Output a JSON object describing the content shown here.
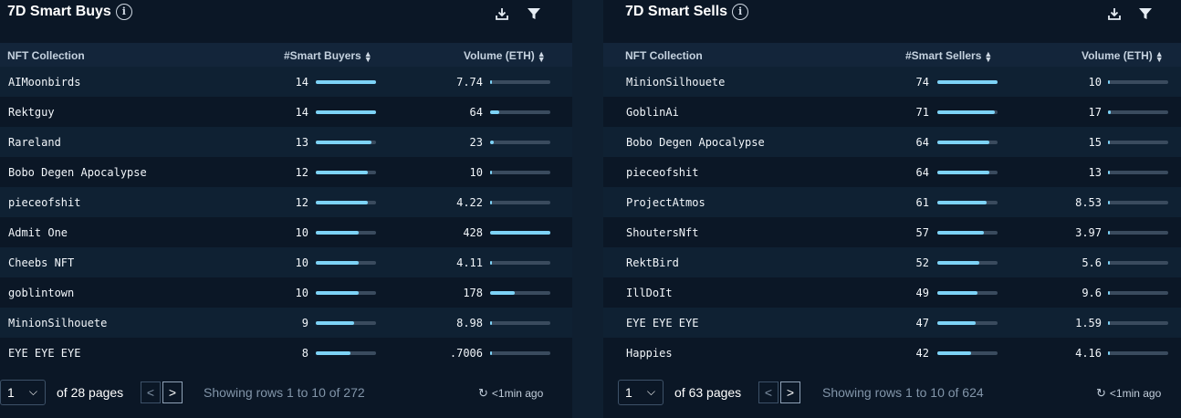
{
  "left": {
    "title": "7D Smart Buys",
    "info": "i",
    "headers": {
      "name": "NFT Collection",
      "count": "#Smart Buyers",
      "volume": "Volume (ETH)"
    },
    "max_count": 14,
    "max_volume": 428,
    "rows": [
      {
        "name": "AIMoonbirds",
        "count": "14",
        "count_val": 14,
        "volume": "7.74",
        "volume_val": 7.74
      },
      {
        "name": "Rektguy",
        "count": "14",
        "count_val": 14,
        "volume": "64",
        "volume_val": 64
      },
      {
        "name": "Rareland",
        "count": "13",
        "count_val": 13,
        "volume": "23",
        "volume_val": 23
      },
      {
        "name": "Bobo Degen Apocalypse",
        "count": "12",
        "count_val": 12,
        "volume": "10",
        "volume_val": 10
      },
      {
        "name": "pieceofshit",
        "count": "12",
        "count_val": 12,
        "volume": "4.22",
        "volume_val": 4.22
      },
      {
        "name": "Admit One",
        "count": "10",
        "count_val": 10,
        "volume": "428",
        "volume_val": 428
      },
      {
        "name": "Cheebs NFT",
        "count": "10",
        "count_val": 10,
        "volume": "4.11",
        "volume_val": 4.11
      },
      {
        "name": "goblintown",
        "count": "10",
        "count_val": 10,
        "volume": "178",
        "volume_val": 178
      },
      {
        "name": "MinionSilhouete",
        "count": "9",
        "count_val": 9,
        "volume": "8.98",
        "volume_val": 8.98
      },
      {
        "name": "EYE EYE EYE",
        "count": "8",
        "count_val": 8,
        "volume": ".7006",
        "volume_val": 0.7006
      }
    ],
    "footer": {
      "page": "1",
      "of_pages": "of 28 pages",
      "prev": "<",
      "next": ">",
      "showing": "Showing rows 1 to 10 of 272",
      "updated": "<1min ago"
    }
  },
  "right": {
    "title": "7D Smart Sells",
    "info": "i",
    "headers": {
      "name": "NFT Collection",
      "count": "#Smart Sellers",
      "volume": "Volume (ETH)"
    },
    "max_count": 74,
    "max_volume": 428,
    "rows": [
      {
        "name": "MinionSilhouete",
        "count": "74",
        "count_val": 74,
        "volume": "10",
        "volume_val": 10
      },
      {
        "name": "GoblinAi",
        "count": "71",
        "count_val": 71,
        "volume": "17",
        "volume_val": 17
      },
      {
        "name": "Bobo Degen Apocalypse",
        "count": "64",
        "count_val": 64,
        "volume": "15",
        "volume_val": 15
      },
      {
        "name": "pieceofshit",
        "count": "64",
        "count_val": 64,
        "volume": "13",
        "volume_val": 13
      },
      {
        "name": "ProjectAtmos",
        "count": "61",
        "count_val": 61,
        "volume": "8.53",
        "volume_val": 8.53
      },
      {
        "name": "ShoutersNft",
        "count": "57",
        "count_val": 57,
        "volume": "3.97",
        "volume_val": 3.97
      },
      {
        "name": "RektBird",
        "count": "52",
        "count_val": 52,
        "volume": "5.6",
        "volume_val": 5.6
      },
      {
        "name": "IllDoIt",
        "count": "49",
        "count_val": 49,
        "volume": "9.6",
        "volume_val": 9.6
      },
      {
        "name": "EYE EYE EYE",
        "count": "47",
        "count_val": 47,
        "volume": "1.59",
        "volume_val": 1.59
      },
      {
        "name": "Happies",
        "count": "42",
        "count_val": 42,
        "volume": "4.16",
        "volume_val": 4.16
      }
    ],
    "footer": {
      "page": "1",
      "of_pages": "of 63 pages",
      "prev": "<",
      "next": ">",
      "showing": "Showing rows 1 to 10 of 624",
      "updated": "<1min ago"
    }
  },
  "icons": {
    "download": "download-icon",
    "filter": "filter-icon",
    "sort": "sort-icon",
    "clock": "refresh-clock-icon"
  },
  "colors": {
    "bar_fill": "#7dd3f7",
    "bar_track": "#3a4b5e",
    "background": "#0b1726"
  }
}
